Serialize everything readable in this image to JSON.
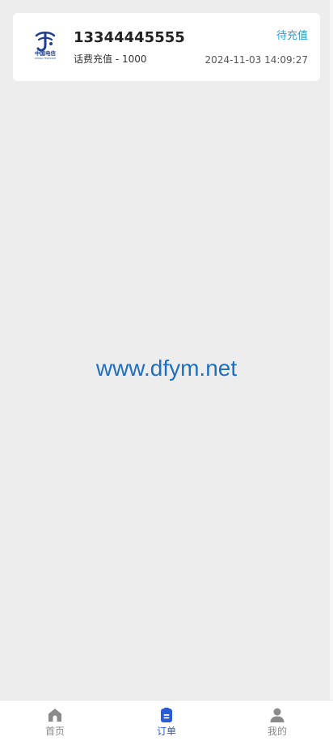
{
  "order": {
    "phone": "13344445555",
    "description": "话费充值 - 1000",
    "status": "待充值",
    "time": "2024-11-03 14:09:27",
    "carrier_logo_caption": "CHINA TELECOM"
  },
  "watermark": "www.dfym.net",
  "tabbar": {
    "tabs": [
      {
        "label": "首页",
        "icon": "home-icon",
        "active": false
      },
      {
        "label": "订单",
        "icon": "order-icon",
        "active": true
      },
      {
        "label": "我的",
        "icon": "user-icon",
        "active": false
      }
    ]
  },
  "colors": {
    "background": "#ededed",
    "status": "#2a9fd6",
    "active_tab": "#2a5bd7",
    "inactive_tab": "#8a8a8a",
    "watermark": "#1f6fc0"
  }
}
